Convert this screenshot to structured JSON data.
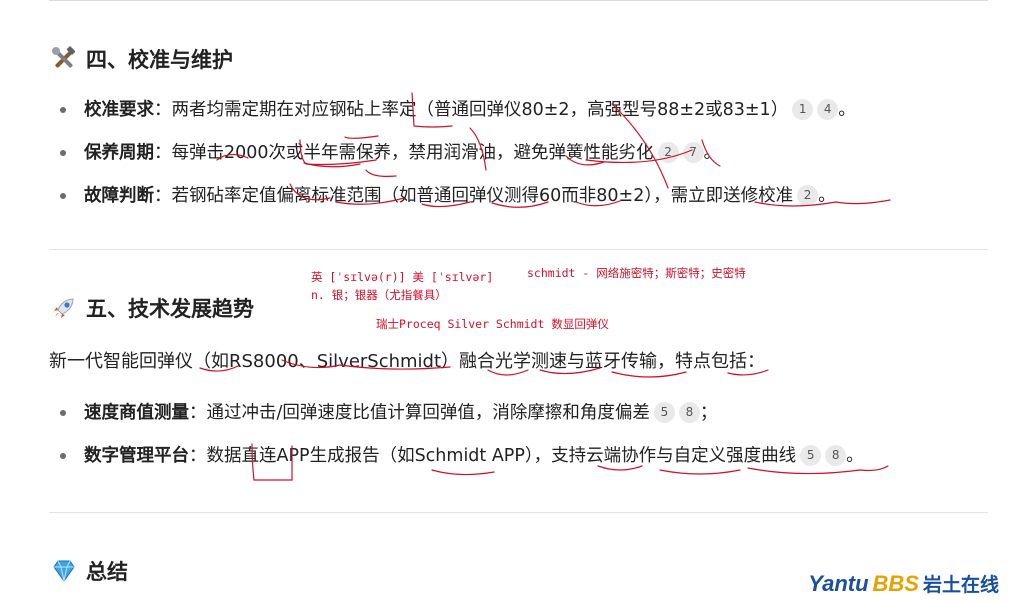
{
  "section4": {
    "title": "四、校准与维护",
    "icon": "tools-icon",
    "items": [
      {
        "term": "校准要求",
        "text": "：两者均需定期在对应钢砧上率定（普通回弹仪80±2，高强型号88±2或83±1）",
        "cites": [
          "1",
          "4"
        ],
        "end": "。"
      },
      {
        "term": "保养周期",
        "text": "：每弹击2000次或半年需保养，禁用润滑油，避免弹簧性能劣化",
        "cites": [
          "2",
          "7"
        ],
        "end": "。"
      },
      {
        "term": "故障判断",
        "text": "：若钢砧率定值偏离标准范围（如普通回弹仪测得60而非80±2），需立即送修校准",
        "cites": [
          "2"
        ],
        "end": "。"
      }
    ]
  },
  "annotations": {
    "silver_phonetic": "英 [ˈsɪlvə(r)] 美 [ˈsɪlvər]",
    "silver_meaning": "n. 银；银器（尤指餐具）",
    "schmidt": "schmidt - 网络施密特；斯密特；史密特",
    "proceq": "瑞士Proceq Silver Schmidt 数显回弹仪"
  },
  "section5": {
    "title": "五、技术发展趋势",
    "icon": "rocket-icon",
    "intro": "新一代智能回弹仪（如RS8000、SilverSchmidt）融合光学测速与蓝牙传输，特点包括：",
    "items": [
      {
        "term": "速度商值测量",
        "text": "：通过冲击/回弹速度比值计算回弹值，消除摩擦和角度偏差",
        "cites": [
          "5",
          "8"
        ],
        "end": "；"
      },
      {
        "term": "数字管理平台",
        "text": "：数据直连APP生成报告（如Schmidt APP），支持云端协作与自定义强度曲线",
        "cites": [
          "5",
          "8"
        ],
        "end": "。"
      }
    ]
  },
  "summary": {
    "title": "总结",
    "icon": "gem-icon"
  },
  "watermark": {
    "part1": "Yantu",
    "part2": "BBS",
    "part3": "岩土在线"
  },
  "colors": {
    "annotation": "#d0102a",
    "logo_blue": "#1a4fa0",
    "logo_orange": "#e8a200"
  }
}
